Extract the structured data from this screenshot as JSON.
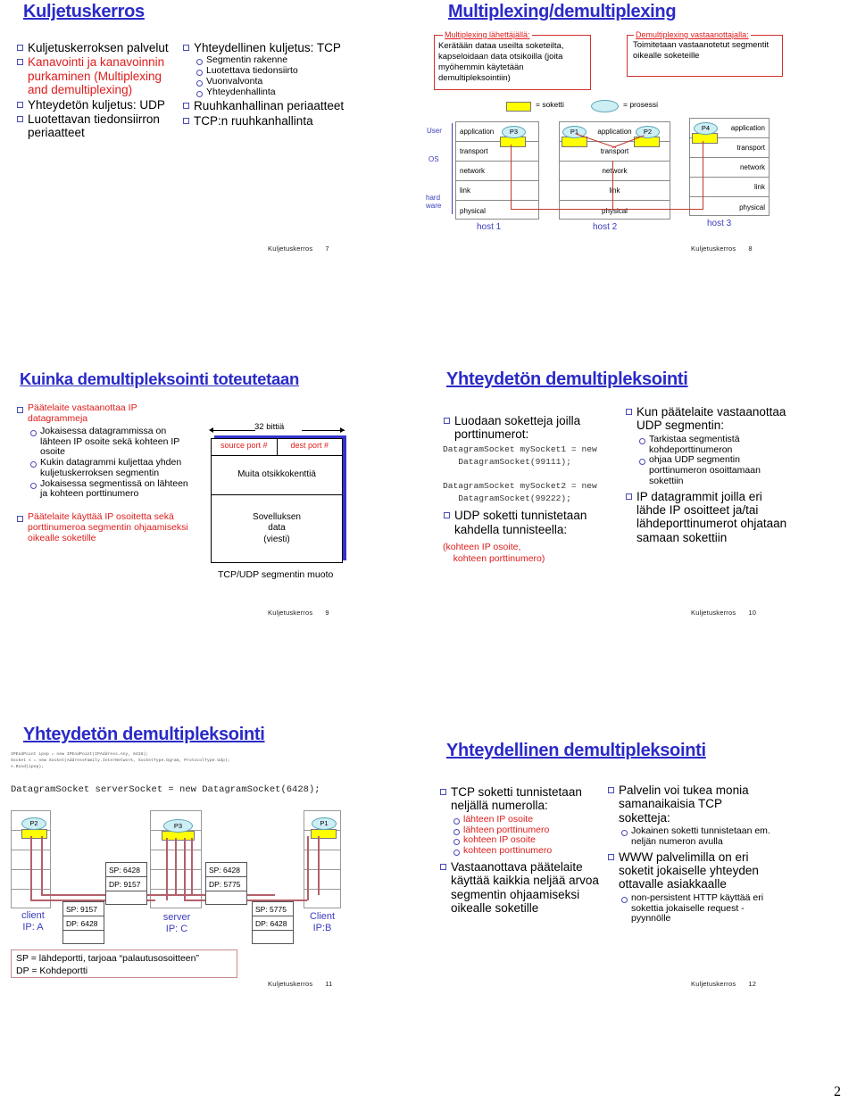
{
  "page": {
    "number": "2"
  },
  "footer_label": "Kuljetuskerros",
  "slides": [
    {
      "id": "slide-7",
      "title": "Kuljetuskerros",
      "page": "7",
      "left_bullets": [
        {
          "text": "Kuljetuskerroksen palvelut",
          "color": "black"
        },
        {
          "text": "Kanavointi ja kanavoinnin purkaminen (Multiplexing and demultiplexing)",
          "color": "red"
        },
        {
          "text": "Yhteydetön kuljetus: UDP",
          "color": "black"
        },
        {
          "text": "Luotettavan tiedonsiirron periaatteet",
          "color": "black"
        }
      ],
      "right_bullets": [
        {
          "text": "Yhteydellinen kuljetus: TCP",
          "color": "black",
          "sub": [
            "Segmentin rakenne",
            "Luotettava tiedonsiirto",
            "Vuonvalvonta",
            "Yhteydenhallinta"
          ]
        },
        {
          "text": "Ruuhkanhallinan periaatteet",
          "color": "black",
          "sub": []
        },
        {
          "text": "TCP:n ruuhkanhallinta",
          "color": "black",
          "sub": []
        }
      ]
    },
    {
      "id": "slide-8",
      "title": "Multiplexing/demultiplexing",
      "page": "8",
      "box_left_caption": "Multiplexing lähettäjällä:",
      "box_left_text": "Kerätään dataa useilta soketeilta, kapseloidaan data otsikoilla (joita myöhemmin käytetään demultipleksointiin)",
      "box_right_caption": "Demultiplexing vastaanottajalla:",
      "box_right_text": "Toimitetaan vastaanotetut segmentit oikealle soketeille",
      "legend_socket": "= soketti",
      "legend_process": "= prosessi",
      "side_labels": [
        "User",
        "OS",
        "hard",
        "ware"
      ],
      "layers": [
        "application",
        "transport",
        "network",
        "link",
        "physical"
      ],
      "hosts": [
        "host 1",
        "host 2",
        "host 3"
      ],
      "processes": [
        "P3",
        "P1",
        "P2",
        "P4"
      ]
    },
    {
      "id": "slide-9",
      "title": "Kuinka demultipleksointi toteutetaan",
      "page": "9",
      "bullets": [
        {
          "text": "Päätelaite vastaanottaa IP datagrammeja",
          "color": "red",
          "sub": [
            "Jokaisessa datagrammissa on lähteen IP osoite sekä kohteen IP osoite",
            "Kukin datagrammi kuljettaa yhden kuljetuskerroksen segmentin",
            "Jokaisessa segmentissä on lähteen ja kohteen porttinumero"
          ]
        },
        {
          "text": "Päätelaite käyttää IP osoitetta sekä porttinumeroa segmentin ohjaamiseksi oikealle soketille",
          "color": "red",
          "sub": []
        }
      ],
      "diagram": {
        "width_label": "32 bittiä",
        "field_source": "source port #",
        "field_dest": "dest port #",
        "field_other": "Muita otsikkokenttiä",
        "field_data": [
          "Sovelluksen",
          "data",
          "(viesti)"
        ],
        "caption": "TCP/UDP segmentin muoto"
      }
    },
    {
      "id": "slide-10",
      "title": "Yhteydetön demultipleksointi",
      "page": "10",
      "left": {
        "bullet1": "Luodaan soketteja joilla porttinumerot:",
        "code1": "DatagramSocket mySocket1 = new\n   DatagramSocket(99111);\n\nDatagramSocket mySocket2 = new\n   DatagramSocket(99222);",
        "bullet2": "UDP soketti tunnistetaan kahdella tunnisteella:",
        "note": "(kohteen IP osoite,\n    kohteen porttinumero)"
      },
      "right": {
        "bullet1": "Kun päätelaite vastaanottaa UDP segmentin:",
        "sub1": [
          "Tarkistaa segmentistä kohdeporttinumeron",
          "ohjaa UDP segmentin porttinumeron osoittamaan sokettiin"
        ],
        "bullet2": "IP datagrammit joilla eri lähde IP osoitteet ja/tai lähdeporttinumerot ohjataan samaan sokettiin"
      }
    },
    {
      "id": "slide-11",
      "title": "Yhteydetön demultipleksointi",
      "page": "11",
      "code_small": "IPEndPoint ipep = new IPEndPoint(IPAddress.Any, 6428);\nSocket s = new Socket(AddressFamily.InterNetwork, SocketType.Dgram, ProtocolType.Udp);\ns.Bind(ipep);",
      "code_big": "DatagramSocket serverSocket = new DatagramSocket(6428);",
      "nodes": [
        {
          "process": "P2",
          "name": "client",
          "ip": "IP: A"
        },
        {
          "process": "P3",
          "name": "server",
          "ip": "IP: C"
        },
        {
          "process": "P1",
          "name": "Client",
          "ip": "IP:B"
        }
      ],
      "packets": [
        {
          "sp": "SP: 9157",
          "dp": "DP: 6428"
        },
        {
          "sp": "SP: 6428",
          "dp": "DP: 9157"
        },
        {
          "sp": "SP: 6428",
          "dp": "DP: 5775"
        },
        {
          "sp": "SP: 5775",
          "dp": "DP: 6428"
        }
      ],
      "legend": "SP = lähdeportti, tarjoaa “palautusosoitteen”\nDP = Kohdeportti"
    },
    {
      "id": "slide-12",
      "title": "Yhteydellinen demultipleksointi",
      "page": "12",
      "left_bullets": [
        {
          "text": "TCP soketti tunnistetaan neljällä numerolla:",
          "color": "black",
          "sub": [
            "lähteen IP osoite",
            "lähteen porttinumero",
            "kohteen IP osoite",
            "kohteen porttinumero"
          ],
          "sub_color": "red"
        },
        {
          "text": "Vastaanottava päätelaite käyttää kaikkia neljää arvoa segmentin ohjaamiseksi oikealle soketille",
          "color": "black",
          "sub": []
        }
      ],
      "right_bullets": [
        {
          "text": "Palvelin voi tukea monia samanaikaisia TCP soketteja:",
          "color": "black",
          "sub": [
            "Jokainen soketti tunnistetaan em. neljän numeron avulla"
          ],
          "sub_color": "black"
        },
        {
          "text": "WWW palvelimilla on eri soketit jokaiselle yhteyden ottavalle asiakkaalle",
          "color": "black",
          "sub": [
            "non-persistent HTTP käyttää eri sokettia jokaiselle request - pyynnölle"
          ],
          "sub_color": "black"
        }
      ]
    }
  ],
  "colors": {
    "title": "#2a2ac8",
    "accent_red": "#e01b1b",
    "socket": "#ffff00",
    "process": "#cdeef5",
    "wire": "#b5606a"
  }
}
